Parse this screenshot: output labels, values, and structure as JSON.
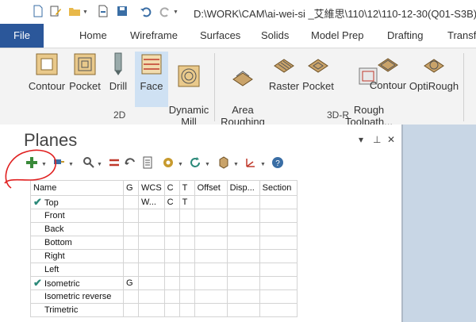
{
  "window": {
    "title": "D:\\WORK\\CAM\\ai-wei-si _艾維思\\110\\12\\110-12-30(Q01-S3B)"
  },
  "tabs": [
    "File",
    "Home",
    "Wireframe",
    "Surfaces",
    "Solids",
    "Model Prep",
    "Drafting",
    "Transf"
  ],
  "ribbon": {
    "group_2d": {
      "label": "2D",
      "buttons": [
        "Contour",
        "Pocket",
        "Drill",
        "Face",
        "Dynamic\nMill"
      ]
    },
    "group_3dr": {
      "label": "3D-R",
      "buttons": [
        "Area\nRoughing",
        "Raster",
        "Pocket",
        "Rough\nToolpath...",
        "Contour",
        "OptiRough"
      ]
    }
  },
  "panel": {
    "title": "Planes",
    "controls": {
      "pin": "▾ ⊥",
      "close": "✕"
    }
  },
  "grid": {
    "columns": [
      "Name",
      "G",
      "WCS",
      "C",
      "T",
      "Offset",
      "Disp...",
      "Section"
    ],
    "rows": [
      {
        "check": true,
        "name": "Top",
        "g": "",
        "wcs": "W...",
        "c": "C",
        "t": "T"
      },
      {
        "check": false,
        "name": "Front",
        "g": "",
        "wcs": "",
        "c": "",
        "t": ""
      },
      {
        "check": false,
        "name": "Back",
        "g": "",
        "wcs": "",
        "c": "",
        "t": ""
      },
      {
        "check": false,
        "name": "Bottom",
        "g": "",
        "wcs": "",
        "c": "",
        "t": ""
      },
      {
        "check": false,
        "name": "Right",
        "g": "",
        "wcs": "",
        "c": "",
        "t": ""
      },
      {
        "check": false,
        "name": "Left",
        "g": "",
        "wcs": "",
        "c": "",
        "t": ""
      },
      {
        "check": true,
        "name": "Isometric",
        "g": "G",
        "wcs": "",
        "c": "",
        "t": ""
      },
      {
        "check": false,
        "name": "Isometric reverse",
        "g": "",
        "wcs": "",
        "c": "",
        "t": ""
      },
      {
        "check": false,
        "name": "Trimetric",
        "g": "",
        "wcs": "",
        "c": "",
        "t": ""
      }
    ]
  },
  "colors": {
    "file_tab": "#2b579a",
    "check": "#2c8a7a",
    "annotation": "#e02020",
    "viewport": "#c8d6e5"
  }
}
